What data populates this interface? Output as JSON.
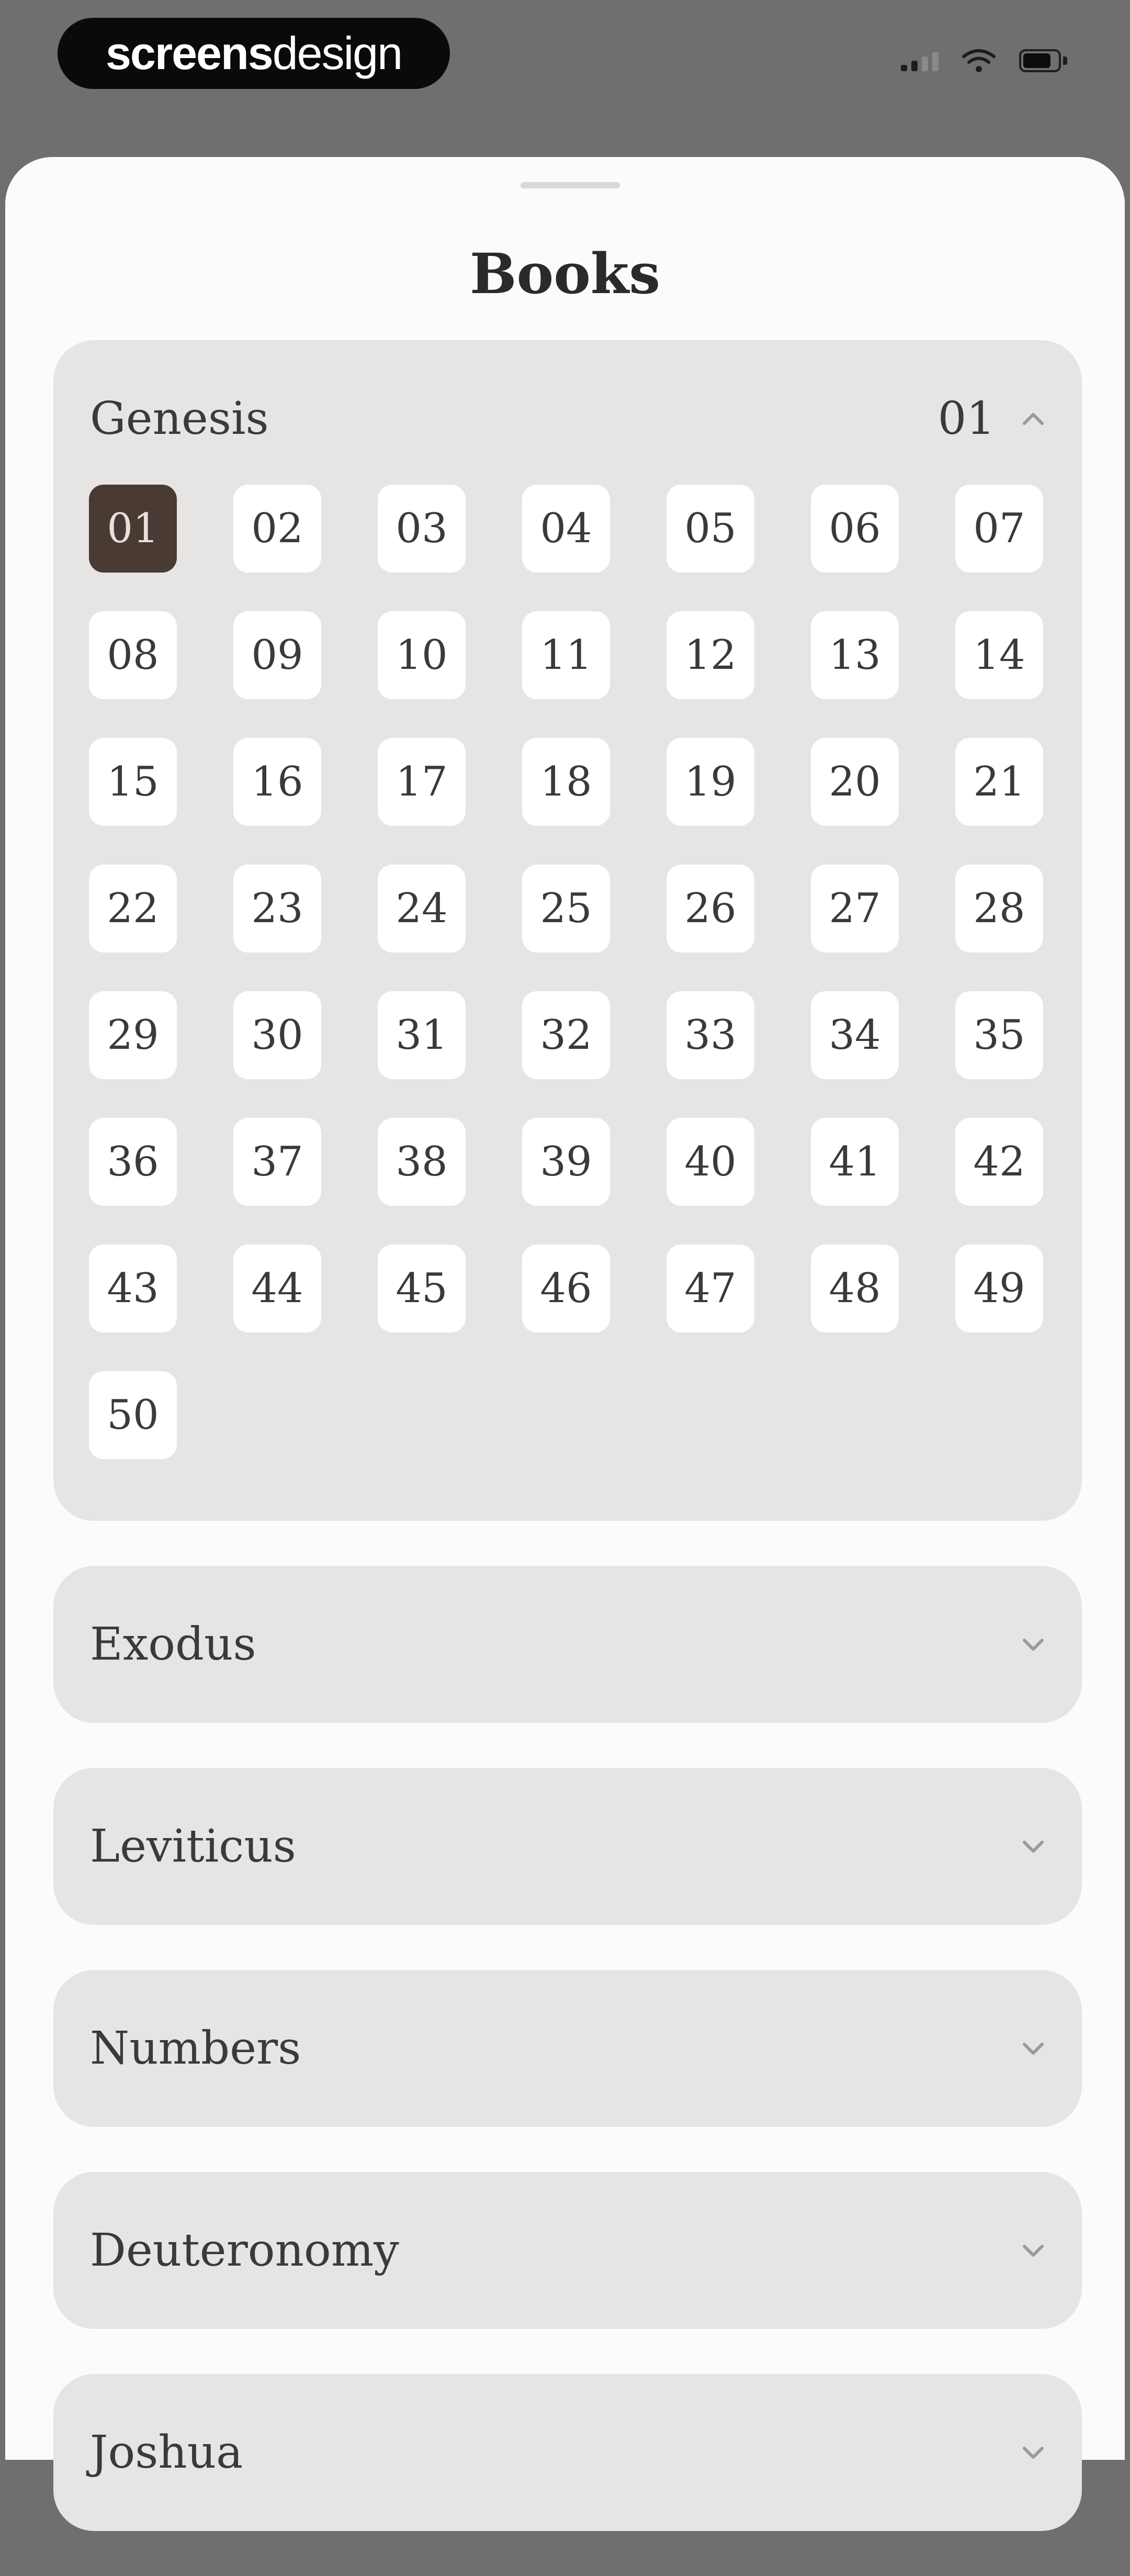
{
  "brand": {
    "bold": "screens",
    "light": "design"
  },
  "sheet": {
    "title": "Books"
  },
  "books": [
    {
      "name": "Genesis",
      "current": "01",
      "expanded": true,
      "chapters": [
        "01",
        "02",
        "03",
        "04",
        "05",
        "06",
        "07",
        "08",
        "09",
        "10",
        "11",
        "12",
        "13",
        "14",
        "15",
        "16",
        "17",
        "18",
        "19",
        "20",
        "21",
        "22",
        "23",
        "24",
        "25",
        "26",
        "27",
        "28",
        "29",
        "30",
        "31",
        "32",
        "33",
        "34",
        "35",
        "36",
        "37",
        "38",
        "39",
        "40",
        "41",
        "42",
        "43",
        "44",
        "45",
        "46",
        "47",
        "48",
        "49",
        "50"
      ],
      "selected_chapter": "01"
    },
    {
      "name": "Exodus",
      "expanded": false
    },
    {
      "name": "Leviticus",
      "expanded": false
    },
    {
      "name": "Numbers",
      "expanded": false
    },
    {
      "name": "Deuteronomy",
      "expanded": false
    },
    {
      "name": "Joshua",
      "expanded": false
    }
  ],
  "icons": {
    "cellular": "cellular-signal-icon",
    "wifi": "wifi-icon",
    "battery": "battery-icon",
    "chevron_up": "chevron-up-icon",
    "chevron_down": "chevron-down-icon"
  },
  "colors": {
    "backdrop": "#6f6f6f",
    "sheet": "#fbfbfb",
    "card": "#e6e5e4",
    "chapter_bg": "#ffffff",
    "selected": "#4a3a34",
    "text": "#3a3a3a"
  }
}
